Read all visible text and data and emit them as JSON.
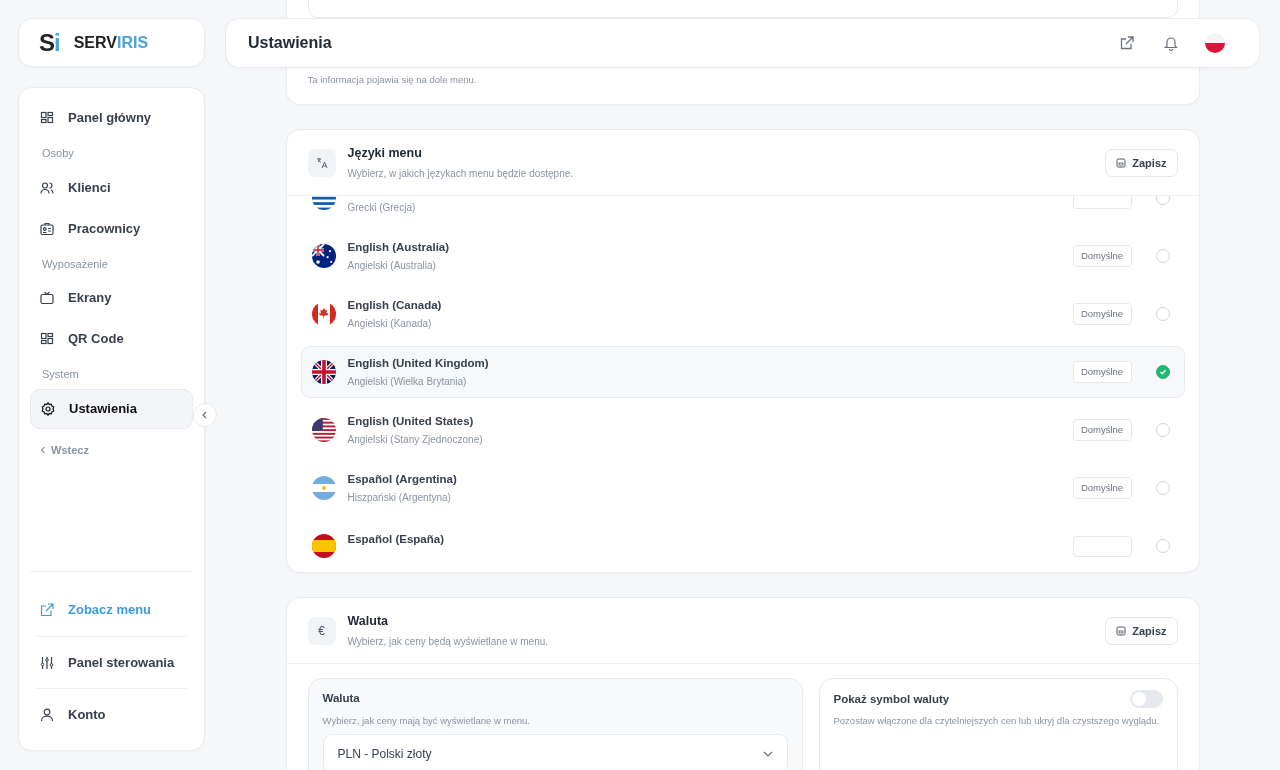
{
  "logo": {
    "mark": [
      "S",
      "i"
    ],
    "wordmark": [
      "SERV",
      "IRIS"
    ]
  },
  "sidebar": {
    "items": [
      {
        "kind": "item",
        "label": "Panel główny",
        "selected": false
      },
      {
        "kind": "section",
        "label": "Osoby"
      },
      {
        "kind": "item",
        "label": "Klienci",
        "selected": false
      },
      {
        "kind": "item",
        "label": "Pracownicy",
        "selected": false
      },
      {
        "kind": "section",
        "label": "Wyposażenie"
      },
      {
        "kind": "item",
        "label": "Ekrany",
        "selected": false
      },
      {
        "kind": "item",
        "label": "QR Code",
        "selected": false
      },
      {
        "kind": "section",
        "label": "System"
      },
      {
        "kind": "item",
        "label": "Ustawienia",
        "selected": true
      },
      {
        "kind": "back",
        "label": "Wstecz"
      }
    ],
    "bottom_items": [
      {
        "kind": "link",
        "label": "Zobacz menu"
      },
      {
        "kind": "item",
        "label": "Panel sterowania"
      },
      {
        "kind": "item",
        "label": "Konto"
      }
    ]
  },
  "header": {
    "title": "Ustawienia"
  },
  "top_card": {
    "hint": "Ta informacja pojawia się na dole menu."
  },
  "languages_card": {
    "title": "Języki menu",
    "subtitle": "Wybierz, w jakich językach menu będzie dostępne.",
    "save_label": "Zapisz",
    "languages": [
      {
        "subtitle": "Grecki (Grecja)",
        "selected": false
      },
      {
        "name": "English (Australia)",
        "subtitle": "Angielski (Australia)",
        "default_label": "Domyślne",
        "selected": false
      },
      {
        "name": "English (Canada)",
        "subtitle": "Angielski (Kanada)",
        "default_label": "Domyślne",
        "selected": false
      },
      {
        "name": "English (United Kingdom)",
        "subtitle": "Angielski (Wielka Brytania)",
        "default_label": "Domyślne",
        "selected": true
      },
      {
        "name": "English (United States)",
        "subtitle": "Angielski (Stany Zjednoczone)",
        "default_label": "Domyślne",
        "selected": false
      },
      {
        "name": "Español (Argentina)",
        "subtitle": "Hiszpański (Argentyna)",
        "default_label": "Domyślne",
        "selected": false
      },
      {
        "name": "Español (España)",
        "selected": false
      }
    ]
  },
  "currency_card": {
    "icon_text": "€",
    "title": "Waluta",
    "subtitle": "Wybierz, jak ceny będą wyświetlane w menu.",
    "save_label": "Zapisz",
    "currency": {
      "label": "Waluta",
      "hint": "Wybierz, jak ceny mają być wyświetlane w menu.",
      "value": "PLN - Polski złoty"
    },
    "show_symbol": {
      "label": "Pokaż symbol waluty",
      "hint": "Pozostaw włączone dla czytelniejszych cen lub ukryj dla czystszego wyglądu.",
      "on": false
    }
  }
}
